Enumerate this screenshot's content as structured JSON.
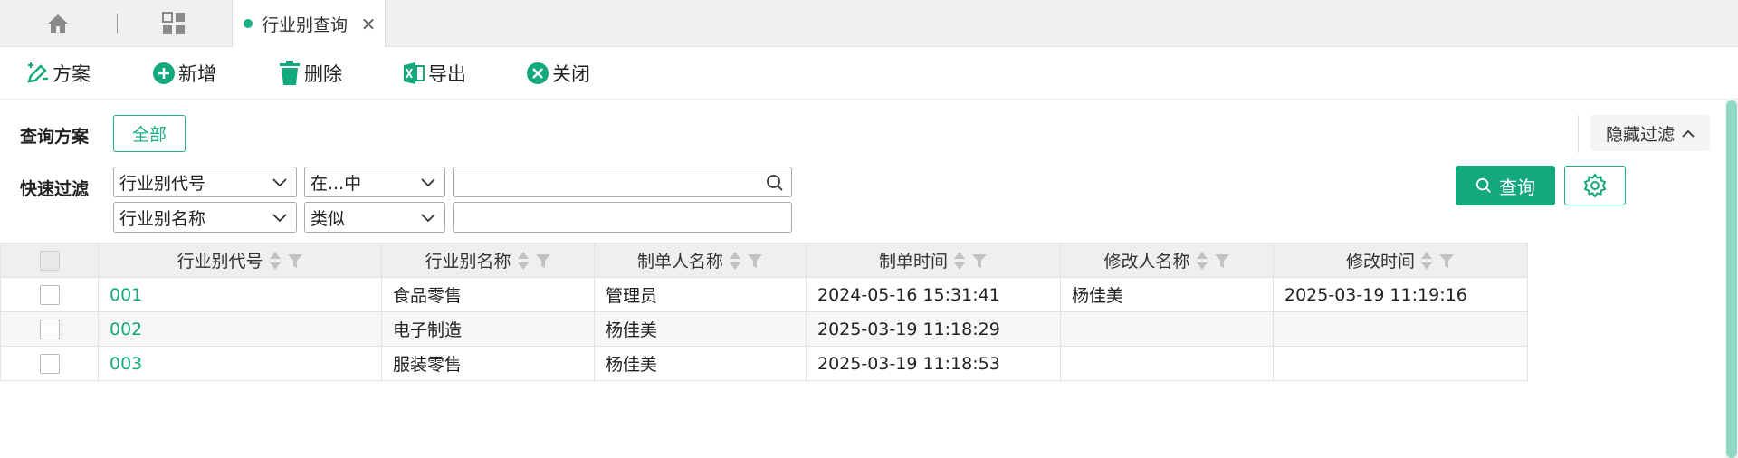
{
  "tabbar": {
    "home_icon": "home-icon",
    "grid_icon": "grid-icon",
    "active_tab": {
      "label": "行业别查询",
      "close": "×"
    }
  },
  "toolbar": {
    "buttons": [
      {
        "label": "方案",
        "icon": "scheme-edit-icon"
      },
      {
        "label": "新增",
        "icon": "plus-circle-icon"
      },
      {
        "label": "删除",
        "icon": "trash-icon"
      },
      {
        "label": "导出",
        "icon": "excel-export-icon"
      },
      {
        "label": "关闭",
        "icon": "close-circle-icon"
      }
    ]
  },
  "filter": {
    "scheme_label": "查询方案",
    "all_button": "全部",
    "hide_filter": "隐藏过滤",
    "quick_label": "快速过滤",
    "rows": [
      {
        "field": "行业别代号",
        "operator": "在...中",
        "value": ""
      },
      {
        "field": "行业别名称",
        "operator": "类似",
        "value": ""
      }
    ],
    "query_button": "查询"
  },
  "table": {
    "columns": [
      "行业别代号",
      "行业别名称",
      "制单人名称",
      "制单时间",
      "修改人名称",
      "修改时间"
    ],
    "rows": [
      [
        "001",
        "食品零售",
        "管理员",
        "2024-05-16 15:31:41",
        "杨佳美",
        "2025-03-19 11:19:16"
      ],
      [
        "002",
        "电子制造",
        "杨佳美",
        "2025-03-19 11:18:29",
        "",
        ""
      ],
      [
        "003",
        "服装零售",
        "杨佳美",
        "2025-03-19 11:18:53",
        "",
        ""
      ]
    ]
  },
  "colors": {
    "accent": "#13a97c",
    "accent_light": "#1aaf87",
    "scroll_thumb": "#8fd9c4"
  }
}
